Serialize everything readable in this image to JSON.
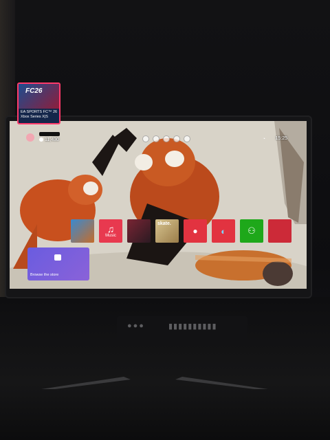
{
  "dashboard": {
    "gamerscore": "11,430",
    "time": "15:25",
    "tiles": [
      {
        "name": "ea-sports-fc26",
        "title": "EA SPORTS FC™ 26",
        "subtitle": "Xbox Series X|S",
        "art_text": "FC26",
        "featured": true
      },
      {
        "name": "forza-horizon",
        "icon": "car-icon",
        "color": "#2c6fb4"
      },
      {
        "name": "apple-music",
        "label": "Music",
        "icon": "music-note-icon",
        "color": "#e8394f"
      },
      {
        "name": "nba-2k25",
        "icon": "basketball-art-icon",
        "color": "#5a2130"
      },
      {
        "name": "skate",
        "label": "skate.",
        "icon": "skate-art-icon",
        "color": "#d8c79b"
      },
      {
        "name": "tips",
        "icon": "lightbulb-icon",
        "color": "#e23340"
      },
      {
        "name": "edge",
        "icon": "edge-browser-icon",
        "color": "#e23340"
      },
      {
        "name": "xbox-app",
        "icon": "xbox-app-icon",
        "color": "#1ea81a"
      },
      {
        "name": "red-tile",
        "icon": "blank-icon",
        "color": "#cc2a38"
      }
    ],
    "store": {
      "label": "Browse the store",
      "icon": "store-bag-icon"
    }
  }
}
